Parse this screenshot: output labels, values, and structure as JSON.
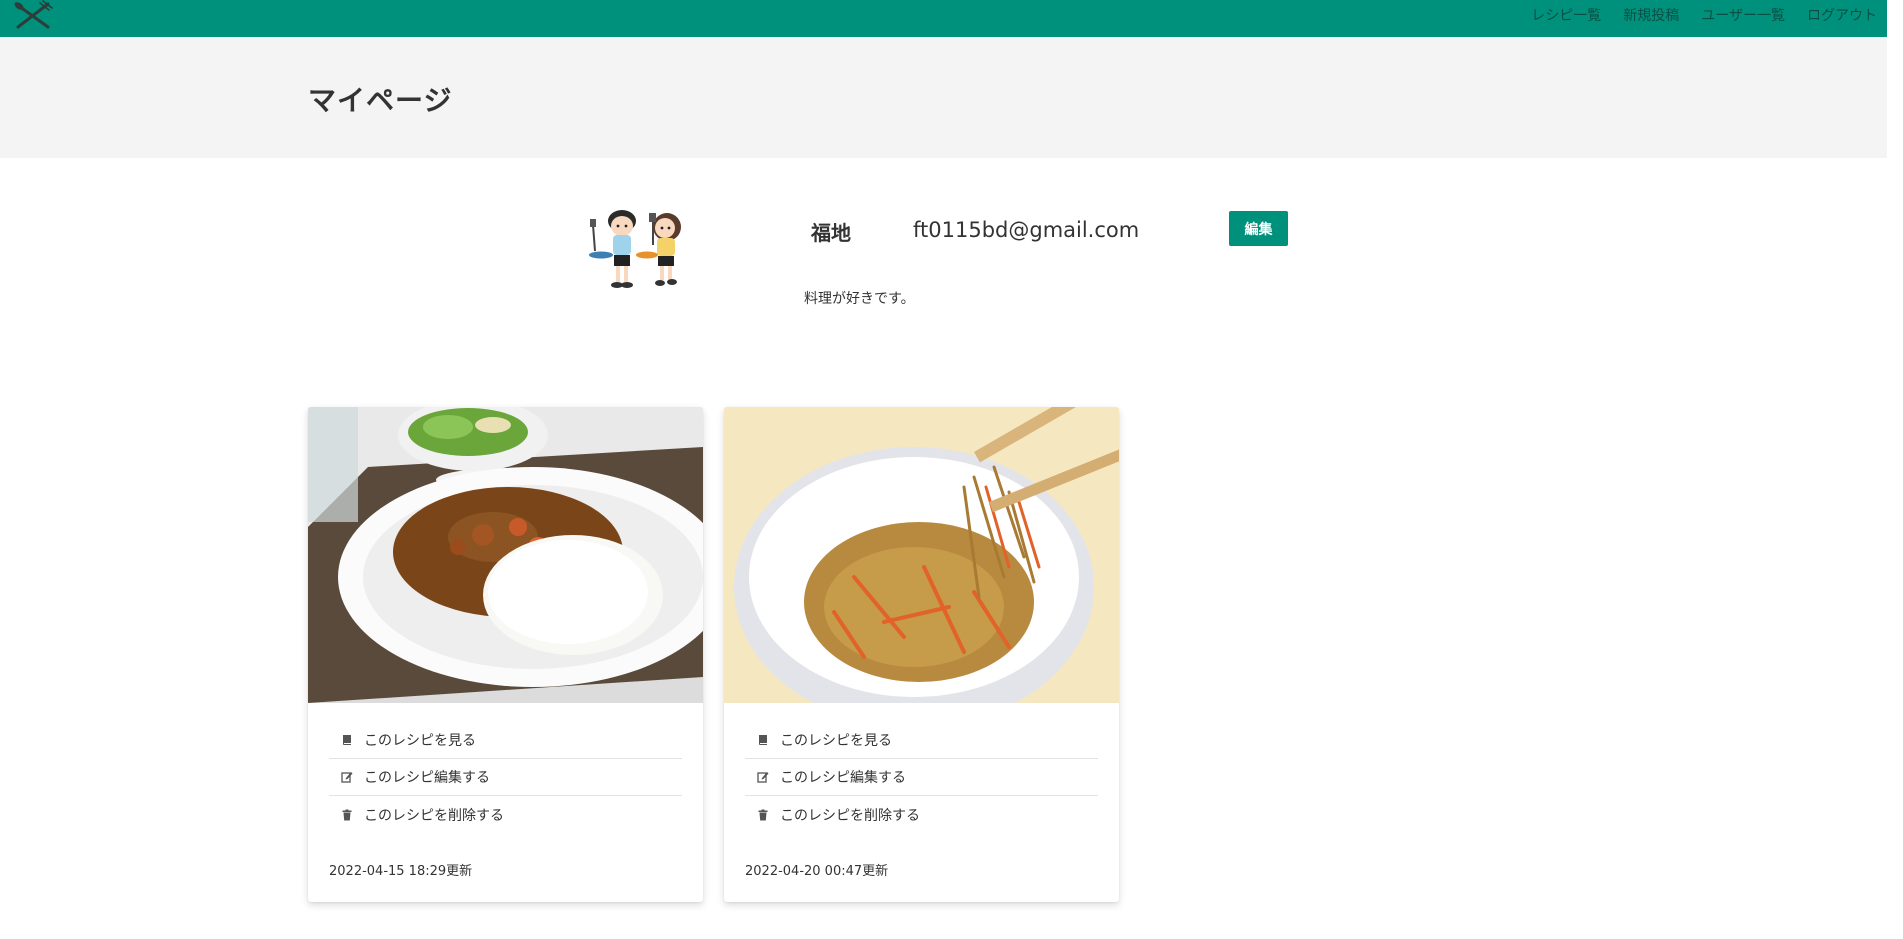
{
  "nav": {
    "items": [
      {
        "label": "レシピ一覧"
      },
      {
        "label": "新規投稿"
      },
      {
        "label": "ユーザー一覧"
      },
      {
        "label": "ログアウト"
      }
    ]
  },
  "header": {
    "title": "マイページ"
  },
  "profile": {
    "name": "福地",
    "email": "ft0115bd@gmail.com",
    "edit_label": "編集",
    "bio": "料理が好きです。"
  },
  "recipes": [
    {
      "view_label": "このレシピを見る",
      "edit_label": "このレシピ編集する",
      "delete_label": "このレシピを削除する",
      "updated": "2022-04-15 18:29更新"
    },
    {
      "view_label": "このレシピを見る",
      "edit_label": "このレシピ編集する",
      "delete_label": "このレシピを削除する",
      "updated": "2022-04-20 00:47更新"
    }
  ],
  "colors": {
    "brand": "#00917c",
    "hero_bg": "#f4f4f4"
  },
  "icons": [
    "fork-knife-logo-icon",
    "book-icon",
    "edit-icon",
    "trash-icon"
  ]
}
